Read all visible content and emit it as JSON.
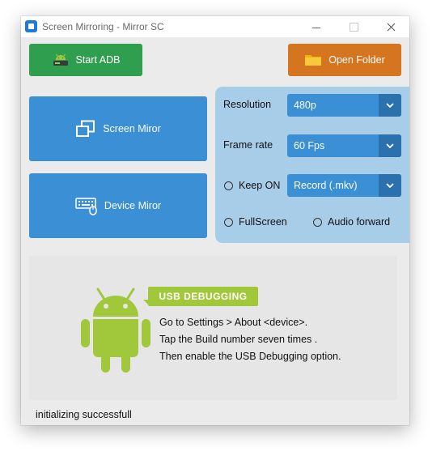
{
  "window": {
    "title": "Screen Mirroring - Mirror SC"
  },
  "toolbar": {
    "start_adb_label": "Start ADB",
    "open_folder_label": "Open Folder"
  },
  "mirror": {
    "screen_label": "Screen Miror",
    "device_label": "Device Miror"
  },
  "settings": {
    "resolution": {
      "label": "Resolution",
      "value": "480p"
    },
    "frame_rate": {
      "label": "Frame rate",
      "value": "60 Fps"
    },
    "keep_on": {
      "label": "Keep ON",
      "checked": false
    },
    "record": {
      "value": "Record (.mkv)"
    },
    "fullscreen": {
      "label": "FullScreen",
      "checked": false
    },
    "audio_forward": {
      "label": "Audio forward",
      "checked": false
    }
  },
  "info": {
    "badge": "USB DEBUGGING",
    "steps": [
      "Go to Settings > About <device>.",
      "Tap the Build number seven times .",
      "Then enable the USB Debugging option."
    ]
  },
  "status": {
    "text": "initializing successfull"
  },
  "colors": {
    "green": "#2f9e4f",
    "orange": "#d6751f",
    "blue": "#3b8fd4",
    "blue_dark": "#2a71ae",
    "panel": "#a8cde9",
    "android": "#a1c83a"
  },
  "icons": {
    "app": "app-icon",
    "adb": "android-drive-icon",
    "folder": "folder-icon",
    "screen": "screen-mirror-icon",
    "device": "keyboard-mouse-icon",
    "dropdown": "chevron-down-icon"
  }
}
